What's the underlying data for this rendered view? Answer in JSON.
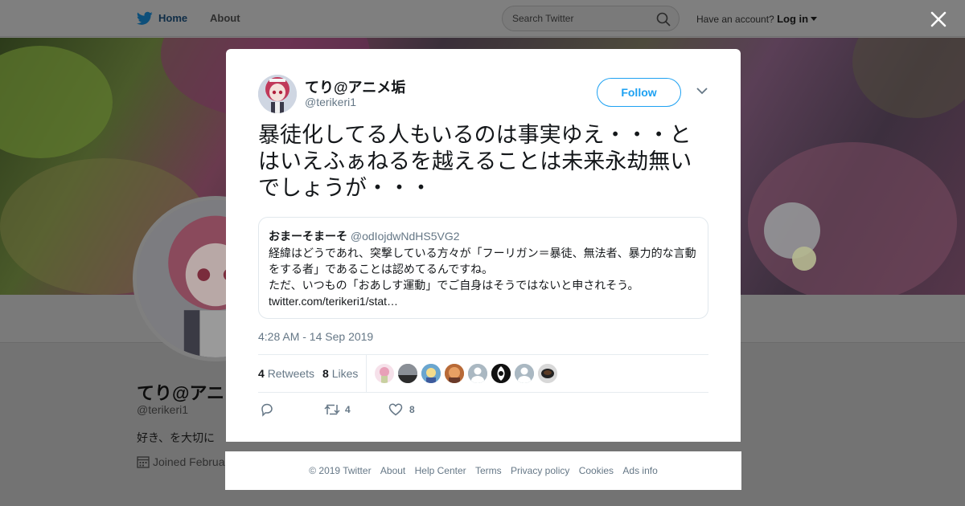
{
  "topbar": {
    "home_label": "Home",
    "about_label": "About",
    "search_placeholder": "Search Twitter",
    "account_prompt": "Have an account?",
    "login_label": "Log in"
  },
  "profile": {
    "name": "てり@アニ",
    "handle": "@terikeri1",
    "bio": "好き、を大切に",
    "joined": "Joined Februa"
  },
  "tweet": {
    "author_name": "てり@アニメ垢",
    "author_handle": "@terikeri1",
    "follow_label": "Follow",
    "text": "暴徒化してる人もいるのは事実ゆえ・・・とはいえふぁねるを越えることは未来永劫無いでしょうが・・・",
    "quote": {
      "author_name": "おまーそまーそ",
      "author_handle": "@odIojdwNdHS5VG2",
      "text_lines": [
        "経緯はどうであれ、突撃している方々が「フーリガン＝暴徒、無法者、暴力的な言動",
        "をする者」であることは認めてるんですね。",
        "ただ、いつもの「おあしす運動」でご自身はそうではないと申されそう。",
        "twitter.com/terikeri1/stat…"
      ]
    },
    "timestamp": "4:28 AM - 14 Sep 2019",
    "retweet_count": "4",
    "retweet_label": "Retweets",
    "like_count": "8",
    "like_label": "Likes",
    "action_retweet_count": "4",
    "action_like_count": "8"
  },
  "likers": [
    "avatar-1",
    "avatar-2",
    "avatar-3",
    "avatar-4",
    "avatar-5",
    "avatar-6",
    "avatar-7",
    "avatar-8"
  ],
  "footer": {
    "copyright": "© 2019 Twitter",
    "links": [
      "About",
      "Help Center",
      "Terms",
      "Privacy policy",
      "Cookies",
      "Ads info"
    ]
  },
  "colors": {
    "accent": "#1da1f2",
    "secondary_text": "#657786",
    "overlay_bg": "#7f7f7f"
  }
}
